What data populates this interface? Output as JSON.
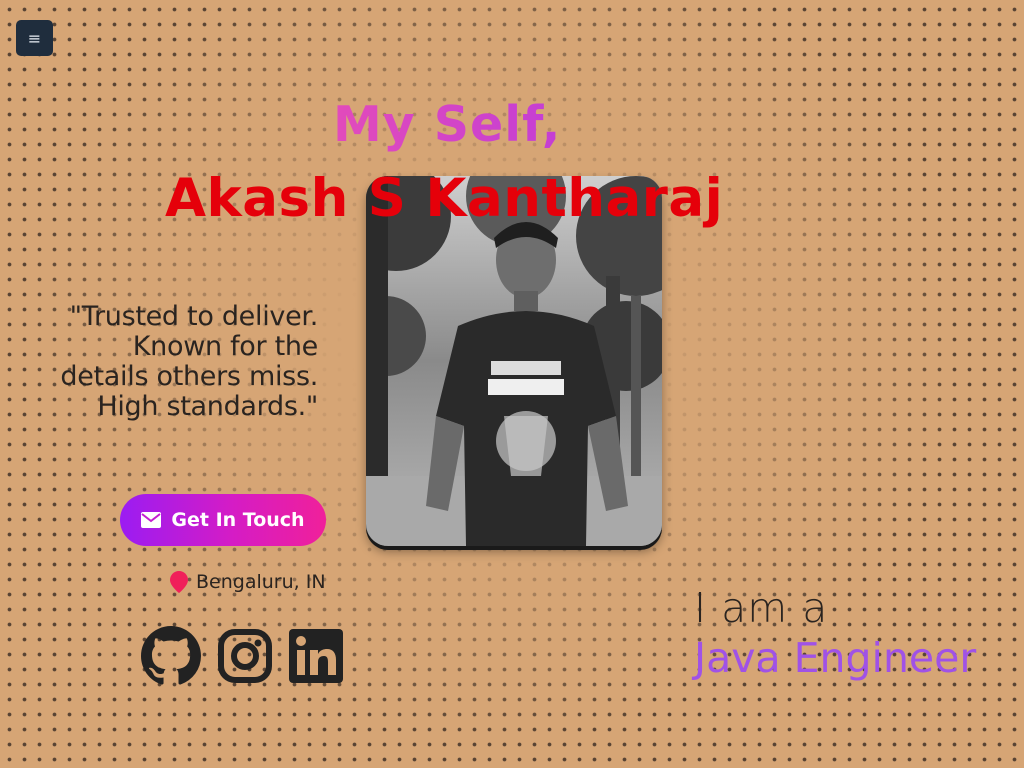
{
  "menu": {
    "icon": "hamburger-icon",
    "label": "≡"
  },
  "hero": {
    "greeting": "My Self,",
    "name": "Akash S Kantharaj",
    "quote": "\"Trusted to deliver. Known for the details others miss. High standards.\"",
    "cta_label": "Get In Touch",
    "cta_icon": "envelope-icon",
    "location": "Bengaluru, IN",
    "location_icon": "map-pin-icon",
    "role_prefix": "I am a",
    "role": "Java Engineer",
    "photo_alt": "Portrait photo"
  },
  "socials": [
    {
      "name": "GitHub",
      "icon": "github-icon"
    },
    {
      "name": "Instagram",
      "icon": "instagram-icon"
    },
    {
      "name": "LinkedIn",
      "icon": "linkedin-icon"
    }
  ],
  "colors": {
    "background": "#d6a575",
    "dots": "#2d231e",
    "greeting": "#d94bc2",
    "name": "#e5000a",
    "role": "#a052e6",
    "cta_start": "#9b1cf2",
    "cta_end": "#f0209a",
    "menu_bg": "#1f2d3d",
    "pin": "#f0205a"
  }
}
